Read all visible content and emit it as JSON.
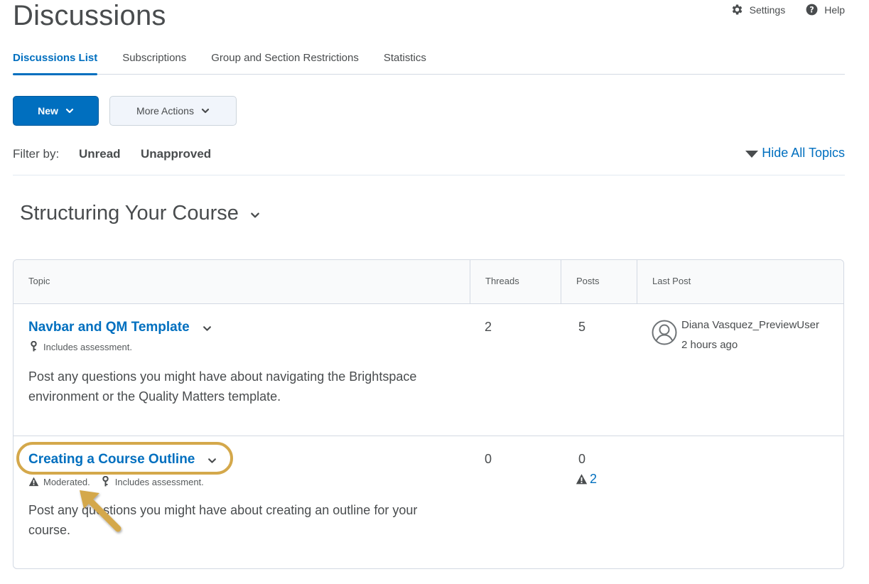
{
  "page": {
    "title": "Discussions"
  },
  "header_links": {
    "settings": "Settings",
    "help": "Help"
  },
  "tabs": [
    {
      "label": "Discussions List",
      "active": true
    },
    {
      "label": "Subscriptions",
      "active": false
    },
    {
      "label": "Group and Section Restrictions",
      "active": false
    },
    {
      "label": "Statistics",
      "active": false
    }
  ],
  "toolbar": {
    "new_label": "New",
    "more_actions_label": "More Actions"
  },
  "filter": {
    "label": "Filter by:",
    "options": [
      "Unread",
      "Unapproved"
    ],
    "hide_all_topics": "Hide All Topics"
  },
  "section": {
    "title": "Structuring Your Course"
  },
  "table": {
    "headers": {
      "topic": "Topic",
      "threads": "Threads",
      "posts": "Posts",
      "last_post": "Last Post"
    },
    "rows": [
      {
        "title": "Navbar and QM Template",
        "assessment": "Includes assessment.",
        "description": "Post any questions you might have about navigating the Brightspace environment or the Quality Matters template.",
        "threads": "2",
        "posts": "5",
        "last_post_user": "Diana Vasquez_PreviewUser",
        "last_post_time": "2 hours ago"
      },
      {
        "title": "Creating a Course Outline",
        "moderated": "Moderated.",
        "assessment": "Includes assessment.",
        "description": "Post any questions you might have about creating an outline for your course.",
        "threads": "0",
        "posts": "0",
        "unapproved_count": "2"
      }
    ]
  },
  "colors": {
    "accent": "#006fbf",
    "text": "#494c4e",
    "highlight": "#d4a84b"
  }
}
